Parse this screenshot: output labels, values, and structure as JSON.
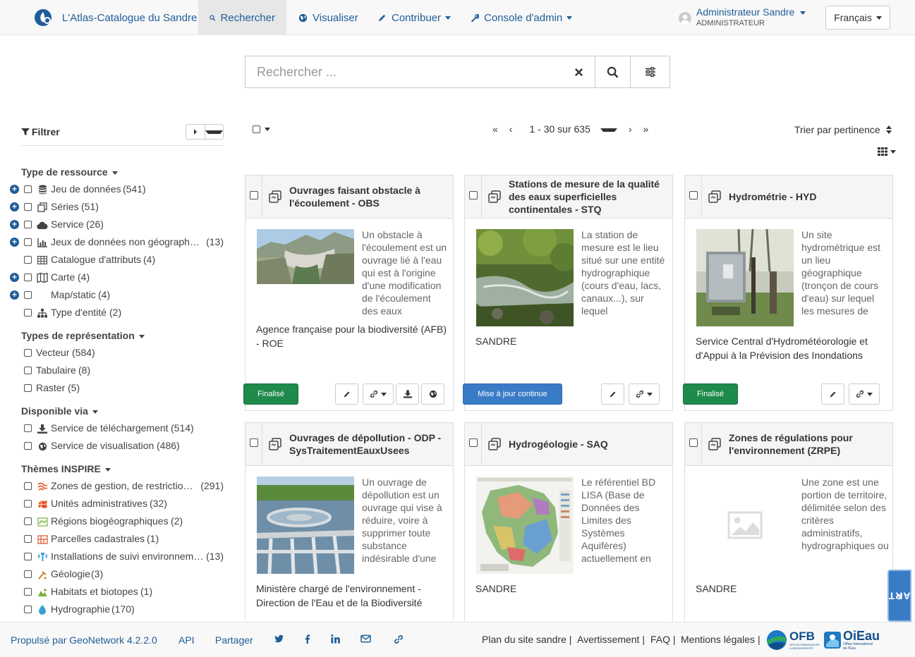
{
  "navbar": {
    "brand": "L'Atlas-Catalogue du Sandre",
    "items": [
      {
        "label": "Rechercher",
        "icon": "search-icon"
      },
      {
        "label": "Visualiser",
        "icon": "globe-icon"
      },
      {
        "label": "Contribuer",
        "icon": "pencil-icon"
      },
      {
        "label": "Console d'admin",
        "icon": "wrench-icon"
      }
    ],
    "user_name": "Administrateur Sandre",
    "user_role": "ADMINISTRATEUR",
    "language": "Français"
  },
  "search": {
    "placeholder": "Rechercher ..."
  },
  "sidebar": {
    "title": "Filtrer",
    "groups": [
      {
        "title": "Type de ressource",
        "items": [
          {
            "label": "Jeu de données",
            "count": "(541)"
          },
          {
            "label": "Séries",
            "count": "(51)"
          },
          {
            "label": "Service",
            "count": "(26)"
          },
          {
            "label": "Jeux de données non géographiques",
            "count": "(13)"
          },
          {
            "label": "Catalogue d'attributs",
            "count": "(4)"
          },
          {
            "label": "Carte",
            "count": "(4)"
          },
          {
            "label": "Map/static",
            "count": "(4)"
          },
          {
            "label": "Type d'entité",
            "count": "(2)"
          }
        ]
      },
      {
        "title": "Types de représentation",
        "items": [
          {
            "label": "Vecteur",
            "count": "(584)"
          },
          {
            "label": "Tabulaire",
            "count": "(8)"
          },
          {
            "label": "Raster",
            "count": "(5)"
          }
        ]
      },
      {
        "title": "Disponible via",
        "items": [
          {
            "label": "Service de téléchargement",
            "count": "(514)"
          },
          {
            "label": "Service de visualisation",
            "count": "(486)"
          }
        ]
      },
      {
        "title": "Thèmes INSPIRE",
        "items": [
          {
            "label": "Zones de gestion, de restriction ou de réglementation",
            "count": "(291)"
          },
          {
            "label": "Unités administratives",
            "count": "(32)"
          },
          {
            "label": "Régions biogéographiques",
            "count": "(2)"
          },
          {
            "label": "Parcelles cadastrales",
            "count": "(1)"
          },
          {
            "label": "Installations de suivi environnemental",
            "count": "(13)"
          },
          {
            "label": "Géologie",
            "count": "(3)"
          },
          {
            "label": "Habitats et biotopes",
            "count": "(1)"
          },
          {
            "label": "Hydrographie",
            "count": "(170)"
          }
        ]
      }
    ]
  },
  "results": {
    "pager": "1 - 30 sur 635",
    "sort": "Trier par pertinence",
    "cards": [
      {
        "title": "Ouvrages faisant obstacle à l'écoulement - OBS",
        "abstract": "Un obstacle à l'écoulement est un ouvrage lié à l'eau qui est à l'origine d'une modification de l'écoulement des eaux",
        "org": "Agence française pour la biodiversité (AFB) - ROE",
        "status": "Finalisé"
      },
      {
        "title": "Stations de mesure de la qualité des eaux superficielles continentales - STQ",
        "abstract": "La station de mesure est le lieu situé sur une entité hydrographique (cours d'eau, lacs, canaux...), sur lequel",
        "org": "SANDRE",
        "status": "Mise à jour continue"
      },
      {
        "title": "Hydrométrie - HYD",
        "abstract": "Un site hydrométrique est un lieu géographique (tronçon de cours d'eau) sur lequel les mesures de débit",
        "org": "Service Central d'Hydrométéorologie et d'Appui à la Prévision des Inondations",
        "status": "Finalisé"
      },
      {
        "title": "Ouvrages de dépollution - ODP - SysTraitementEauxUsees",
        "abstract": "Un ouvrage de dépollution est un ouvrage qui vise à réduire, voire à supprimer toute substance indésirable d'une eau",
        "org": "Ministère chargé de l'environnement - Direction de l'Eau et de la Biodiversité",
        "status": ""
      },
      {
        "title": "Hydrogéologie - SAQ",
        "abstract": "Le référentiel BD LISA (Base de Données des Limites des Systèmes Aquifères) actuellement en vigueur",
        "org": "SANDRE",
        "status": ""
      },
      {
        "title": "Zones de régulations pour l'environnement (ZRPE)",
        "abstract": "Une zone est une portion de territoire, délimitée selon des critères administratifs, hydrographiques ou",
        "org": "SANDRE",
        "status": ""
      }
    ]
  },
  "carte_tab": "CARTE",
  "footer": {
    "powered": "Propulsé par GeoNetwork 4.2.2.0",
    "api": "API",
    "share": "Partager",
    "plan": "Plan du site sandre |",
    "warning": "Avertissement |",
    "faq": "FAQ |",
    "legal": "Mentions légales |",
    "logo_ofb": "OFB",
    "logo_ofb_sub": "OFFICE FRANÇAIS DE LA BIODIVERSITÉ",
    "logo_oieau": "OiEau",
    "logo_oieau_sub": "Office International de l'Eau"
  },
  "colors": {
    "link": "#1f5d99",
    "finalise": "#1e8a4c",
    "continue": "#3a7bc6"
  }
}
